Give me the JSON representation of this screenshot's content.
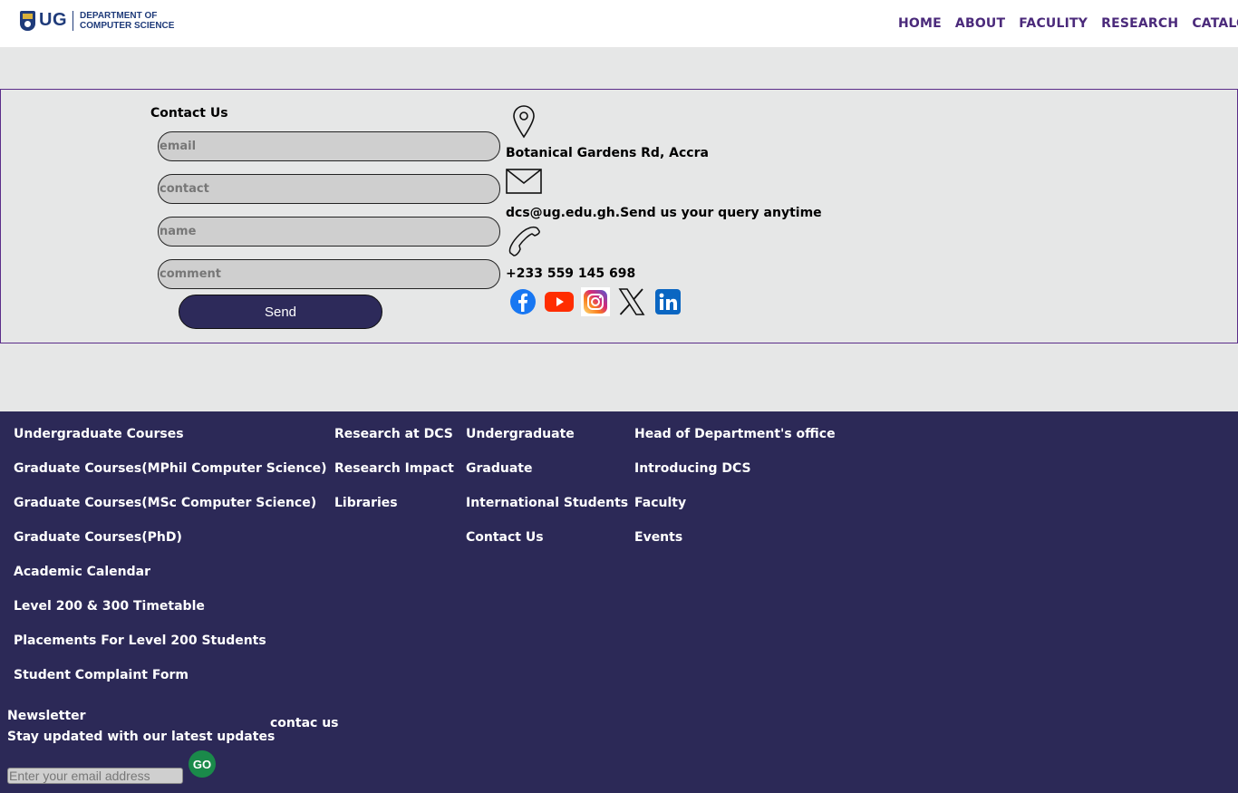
{
  "header": {
    "logo_ug": "UG",
    "logo_line1": "DEPARTMENT OF",
    "logo_line2": "COMPUTER SCIENCE",
    "nav": [
      "HOME",
      "ABOUT",
      "FACULITY",
      "RESEARCH",
      "CATALOG"
    ]
  },
  "contact": {
    "title": "Contact Us",
    "fields": {
      "email_placeholder": "email",
      "contact_placeholder": "contact",
      "name_placeholder": "name",
      "comment_placeholder": "comment"
    },
    "send_label": "Send",
    "address": "Botanical Gardens Rd, Accra",
    "email": "dcs@ug.edu.gh.Send us your query anytime",
    "phone": "+233 559 145 698",
    "socials": [
      "facebook-icon",
      "youtube-icon",
      "instagram-icon",
      "x-icon",
      "linkedin-icon"
    ]
  },
  "footer": {
    "col1": [
      "Undergraduate Courses",
      "Graduate Courses(MPhil Computer Science)",
      "Graduate Courses(MSc Computer Science)",
      "Graduate Courses(PhD)",
      "Academic Calendar",
      "Level 200 & 300 Timetable",
      "Placements For Level 200 Students",
      "Student Complaint Form"
    ],
    "col2": [
      "Research at DCS",
      "Research Impact",
      "Libraries"
    ],
    "col3": [
      "Undergraduate",
      "Graduate",
      "International Students",
      "Contact Us"
    ],
    "col4": [
      "Head of Department's office",
      "Introducing DCS",
      "Faculty",
      "Events"
    ],
    "newsletter_title": "Newsletter",
    "newsletter_sub": "Stay updated with our latest updates",
    "contac_us": "contac us",
    "newsletter_placeholder": "Enter your email address",
    "go_label": "GO"
  },
  "colors": {
    "nav": "#4b2a7b",
    "footer_bg": "#2c2957",
    "send_bg": "#2d2a5a",
    "go_bg": "#1a8a4a"
  }
}
